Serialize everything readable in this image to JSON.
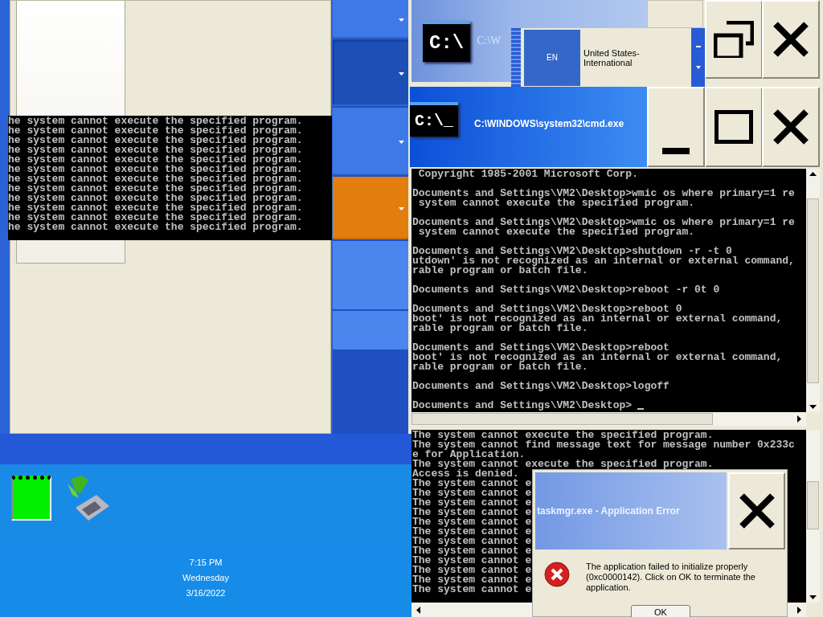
{
  "left_panel": {
    "side_buttons": [
      {
        "selected": false,
        "pressed": false,
        "expandable": true
      },
      {
        "selected": false,
        "pressed": true,
        "expandable": true
      },
      {
        "selected": false,
        "pressed": false,
        "expandable": true
      },
      {
        "selected": true,
        "pressed": false,
        "expandable": true
      },
      {
        "selected": false,
        "pressed": false,
        "expandable": false
      },
      {
        "selected": false,
        "pressed": false,
        "expandable": false
      }
    ]
  },
  "overlay_console": {
    "lines": [
      "he system cannot execute the specified program.",
      "he system cannot execute the specified program.",
      "he system cannot execute the specified program.",
      "he system cannot execute the specified program.",
      "he system cannot execute the specified program.",
      "he system cannot execute the specified program.",
      "he system cannot execute the specified program.",
      "he system cannot execute the specified program.",
      "he system cannot execute the specified program.",
      "he system cannot execute the specified program.",
      "he system cannot execute the specified program.",
      "he system cannot execute the specified program."
    ]
  },
  "tray": {
    "clock": {
      "time": "7:15 PM",
      "day": "Wednesday",
      "date": "3/16/2022"
    }
  },
  "back_window": {
    "icon_text": "C:\\",
    "title": "C:\\W"
  },
  "language_bar": {
    "code": "EN",
    "layout": "United States-International"
  },
  "cmd_window": {
    "icon_text": "C:\\_",
    "title": "C:\\WINDOWS\\system32\\cmd.exe",
    "console_blocks": [
      [
        " Copyright 1985-2001 Microsoft Corp."
      ],
      [
        "Documents and Settings\\VM2\\Desktop>wmic os where primary=1 re",
        " system cannot execute the specified program."
      ],
      [
        "Documents and Settings\\VM2\\Desktop>wmic os where primary=1 re",
        " system cannot execute the specified program."
      ],
      [
        "Documents and Settings\\VM2\\Desktop>shutdown -r -t 0",
        "utdown' is not recognized as an internal or external command,",
        "rable program or batch file."
      ],
      [
        "Documents and Settings\\VM2\\Desktop>reboot -r 0t 0"
      ],
      [
        "Documents and Settings\\VM2\\Desktop>reboot 0",
        "boot' is not recognized as an internal or external command,",
        "rable program or batch file."
      ],
      [
        "Documents and Settings\\VM2\\Desktop>reboot",
        "boot' is not recognized as an internal or external command,",
        "rable program or batch file."
      ],
      [
        "Documents and Settings\\VM2\\Desktop>logoff"
      ],
      [
        "Documents and Settings\\VM2\\Desktop>"
      ]
    ]
  },
  "lower_console": {
    "lines": [
      "The system cannot execute the specified program.",
      "The system cannot find message text for message number 0x233c",
      "e for Application.",
      "The system cannot execute the specified program.",
      "Access is denied.",
      "The system cannot e",
      "The system cannot e",
      "The system cannot e",
      "The system cannot e",
      "The system cannot e",
      "The system cannot e",
      "The system cannot e",
      "The system cannot e",
      "The system cannot e",
      "The system cannot e",
      "The system cannot e",
      "The system cannot e"
    ]
  },
  "error_dialog": {
    "title": "taskmgr.exe - Application Error",
    "message": "The application failed to initialize properly (0xc0000142). Click on OK to terminate the application.",
    "button": "OK"
  }
}
